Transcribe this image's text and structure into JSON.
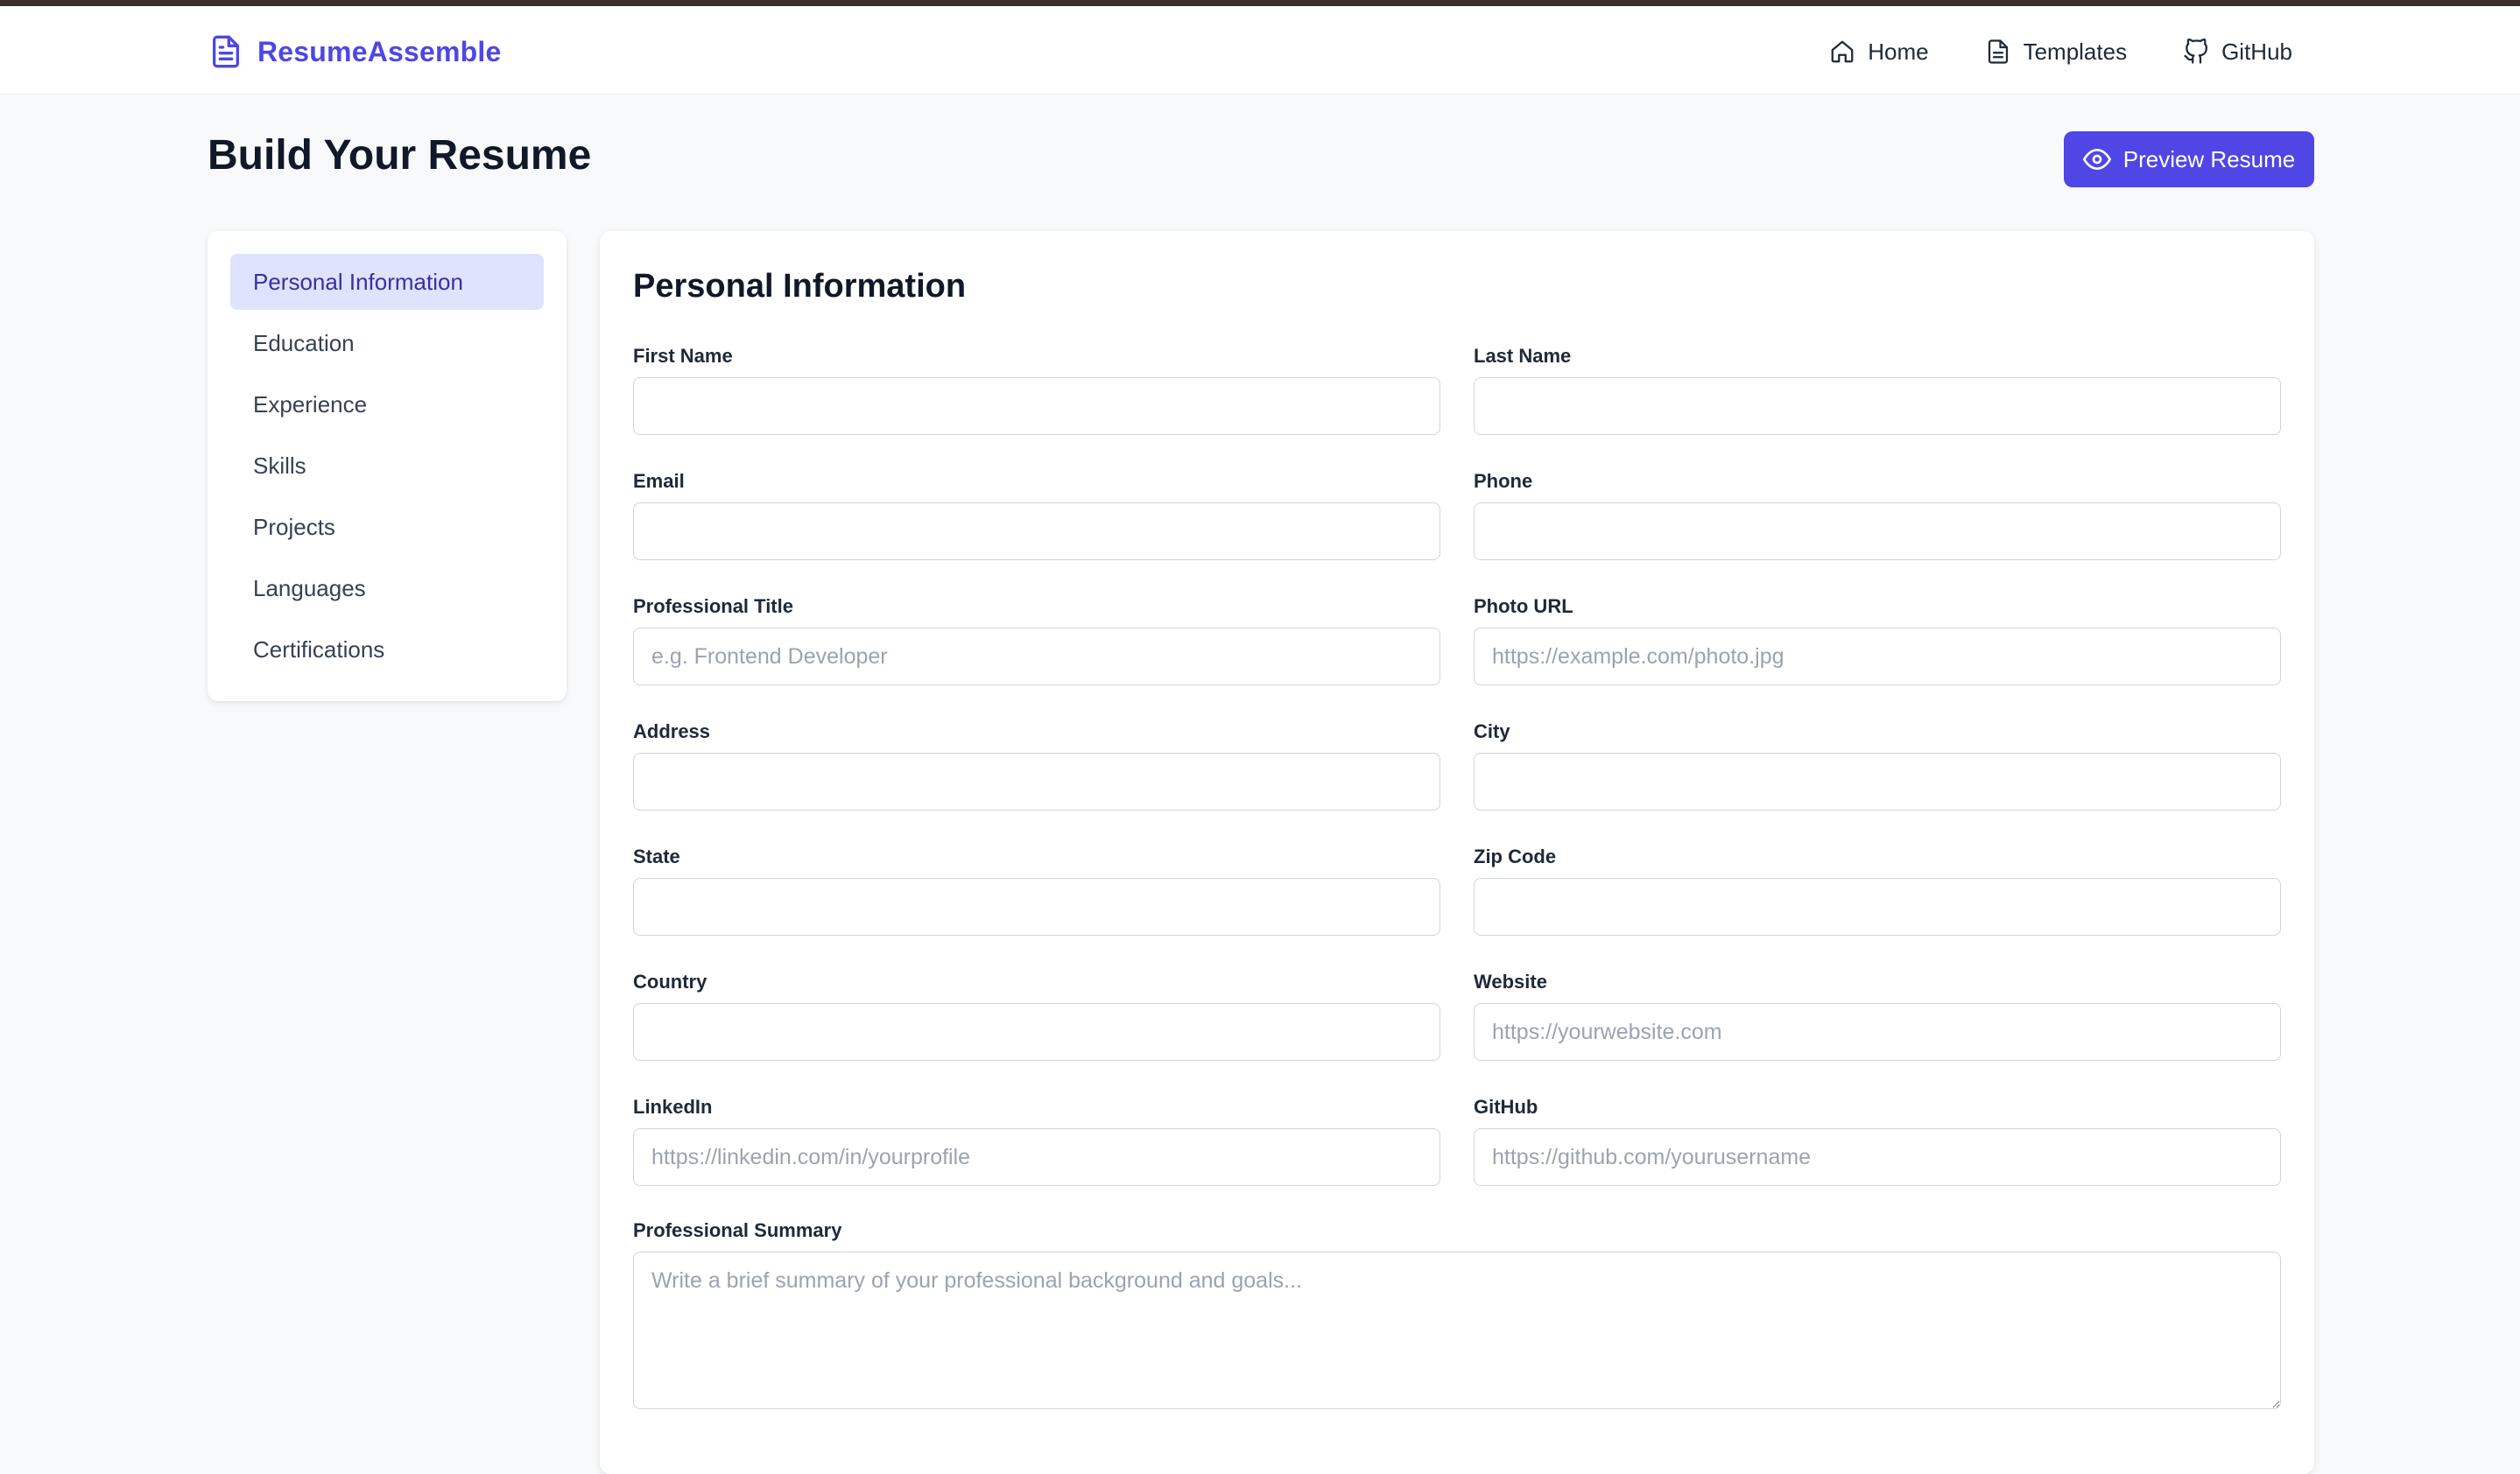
{
  "brand": {
    "name": "ResumeAssemble",
    "icon": "document-icon",
    "color": "#4f46e5"
  },
  "nav": {
    "links": [
      {
        "label": "Home",
        "icon": "home-icon"
      },
      {
        "label": "Templates",
        "icon": "document-icon"
      },
      {
        "label": "GitHub",
        "icon": "github-icon"
      }
    ]
  },
  "page": {
    "title": "Build Your Resume",
    "preview_button": {
      "label": "Preview Resume",
      "icon": "eye-icon",
      "color": "#4f46e5"
    }
  },
  "sidebar": {
    "items": [
      {
        "label": "Personal Information",
        "active": true
      },
      {
        "label": "Education",
        "active": false
      },
      {
        "label": "Experience",
        "active": false
      },
      {
        "label": "Skills",
        "active": false
      },
      {
        "label": "Projects",
        "active": false
      },
      {
        "label": "Languages",
        "active": false
      },
      {
        "label": "Certifications",
        "active": false
      }
    ]
  },
  "form": {
    "title": "Personal Information",
    "fields": {
      "first_name": {
        "label": "First Name",
        "value": "",
        "placeholder": ""
      },
      "last_name": {
        "label": "Last Name",
        "value": "",
        "placeholder": ""
      },
      "email": {
        "label": "Email",
        "value": "",
        "placeholder": ""
      },
      "phone": {
        "label": "Phone",
        "value": "",
        "placeholder": ""
      },
      "professional_title": {
        "label": "Professional Title",
        "value": "",
        "placeholder": "e.g. Frontend Developer"
      },
      "photo_url": {
        "label": "Photo URL",
        "value": "",
        "placeholder": "https://example.com/photo.jpg"
      },
      "address": {
        "label": "Address",
        "value": "",
        "placeholder": ""
      },
      "city": {
        "label": "City",
        "value": "",
        "placeholder": ""
      },
      "state": {
        "label": "State",
        "value": "",
        "placeholder": ""
      },
      "zip_code": {
        "label": "Zip Code",
        "value": "",
        "placeholder": ""
      },
      "country": {
        "label": "Country",
        "value": "",
        "placeholder": ""
      },
      "website": {
        "label": "Website",
        "value": "",
        "placeholder": "https://yourwebsite.com"
      },
      "linkedin": {
        "label": "LinkedIn",
        "value": "",
        "placeholder": "https://linkedin.com/in/yourprofile"
      },
      "github": {
        "label": "GitHub",
        "value": "",
        "placeholder": "https://github.com/yourusername"
      },
      "summary": {
        "label": "Professional Summary",
        "value": "",
        "placeholder": "Write a brief summary of your professional background and goals..."
      }
    }
  }
}
